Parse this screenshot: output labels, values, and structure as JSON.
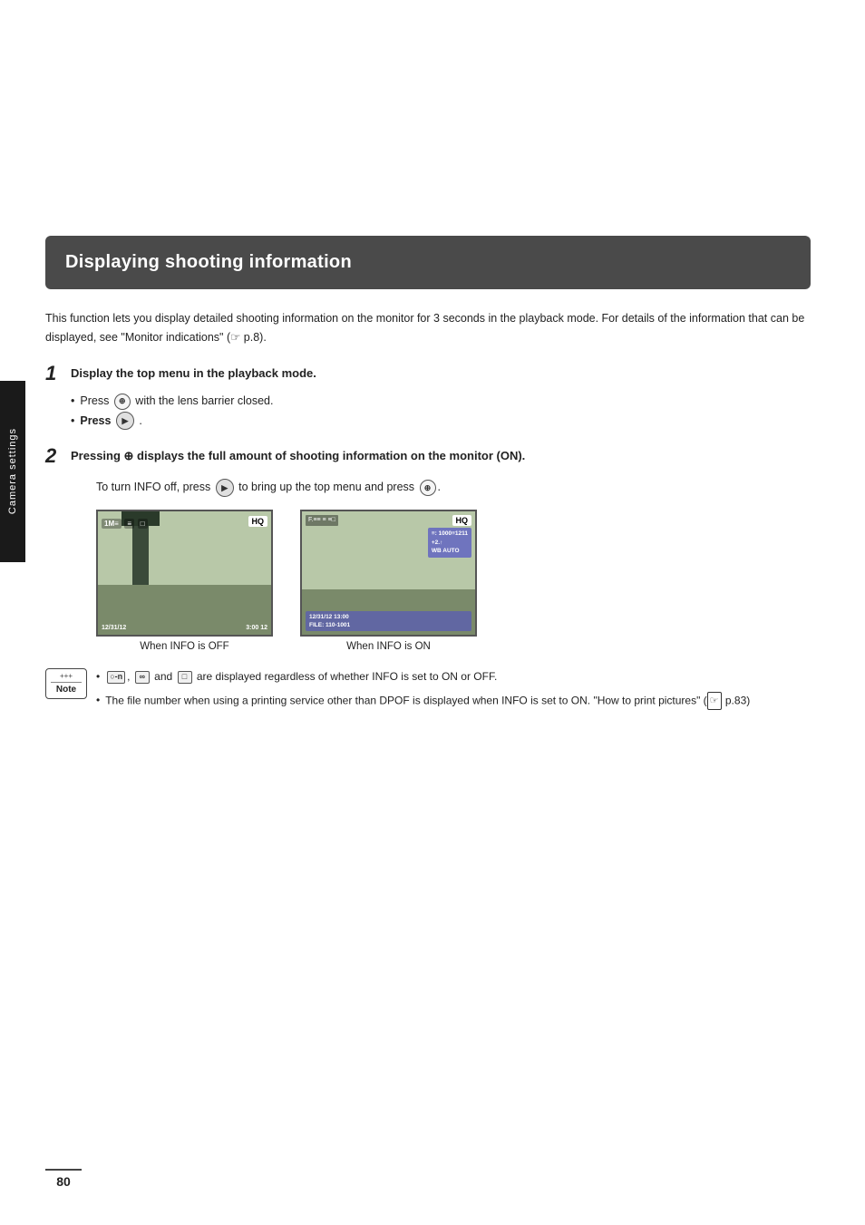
{
  "page": {
    "number": "80",
    "sidebar_label": "Camera settings"
  },
  "title": "Displaying shooting information",
  "intro": "This function lets you display detailed shooting information on the monitor for 3 seconds in the playback mode. For details of the information that can be displayed, see \"Monitor indications\" (☞ p.8).",
  "steps": [
    {
      "number": "1",
      "title": "Display the top menu in the playback mode.",
      "bullets": [
        "Press ⊕ with the lens barrier closed.",
        "Press ▶."
      ]
    },
    {
      "number": "2",
      "title": "Pressing ⊕ displays the full amount of shooting information on the monitor (ON).",
      "instruction": "To turn INFO off, press ▶ to bring up the top menu and press ⊕.",
      "images": [
        {
          "label": "When INFO is OFF",
          "type": "off"
        },
        {
          "label": "When INFO is ON",
          "type": "on"
        }
      ]
    }
  ],
  "notes": [
    {
      "text": "○-n, ∞ and □ are displayed regardless of whether INFO is set to ON or OFF.",
      "icon_parts": [
        "○-n",
        "∞",
        "□"
      ]
    },
    {
      "text": "The file number when using a printing service other than DPOF is displayed when INFO is set to ON. \"How to print pictures\" (☞ p.83)"
    }
  ]
}
